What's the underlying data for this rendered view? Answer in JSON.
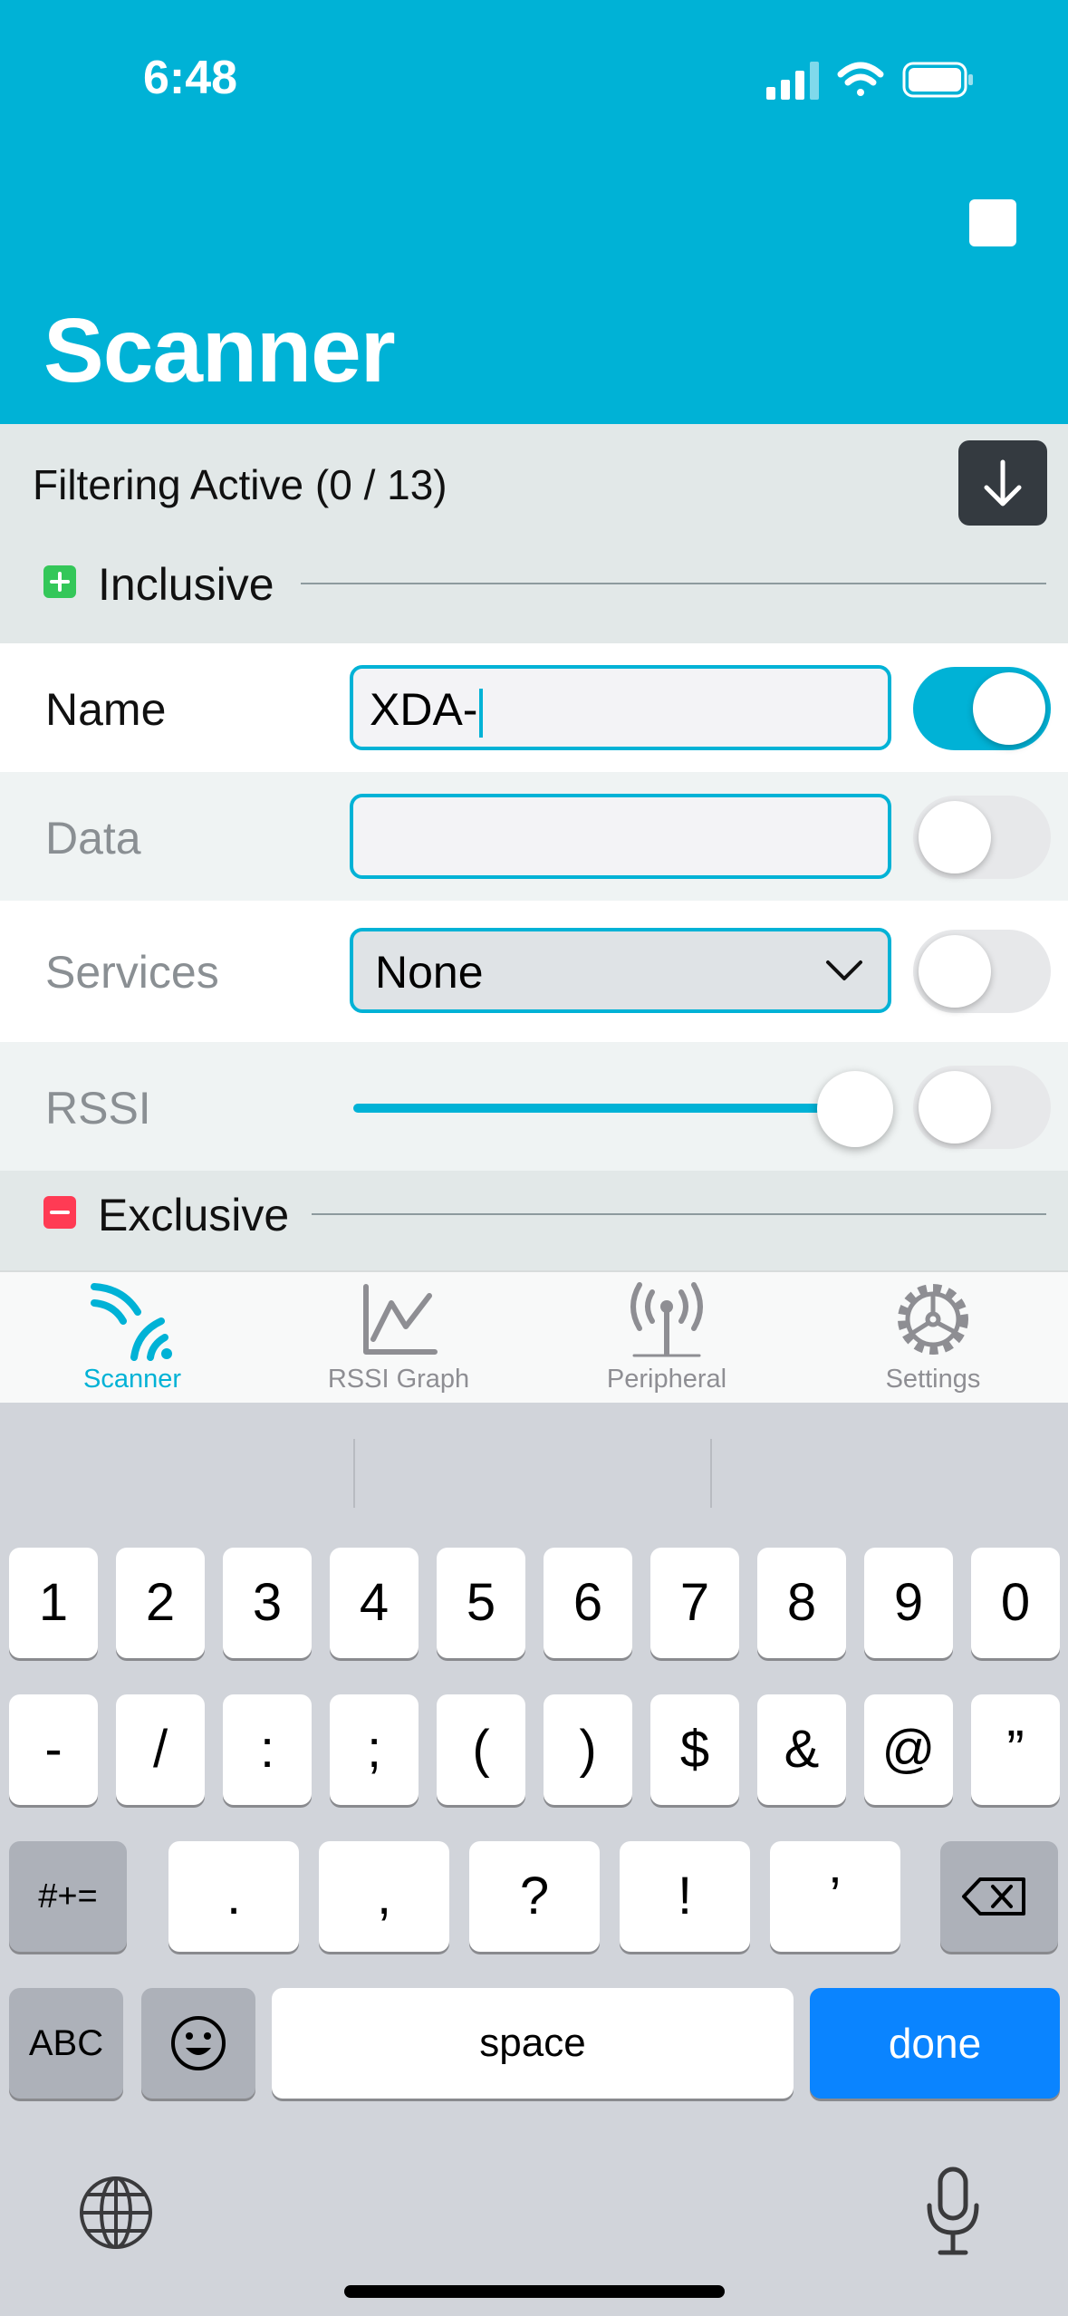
{
  "status_bar": {
    "time": "6:48"
  },
  "header": {
    "title": "Scanner"
  },
  "filter": {
    "title": "Filtering Active (0 / 13)",
    "inclusive_label": "Inclusive",
    "exclusive_label": "Exclusive",
    "rows": {
      "name": {
        "label": "Name",
        "value": "XDA-",
        "enabled": true
      },
      "data": {
        "label": "Data",
        "value": "",
        "enabled": false
      },
      "services": {
        "label": "Services",
        "value": "None",
        "enabled": false
      },
      "rssi": {
        "label": "RSSI",
        "slider_fraction": 0.95,
        "enabled": false
      }
    }
  },
  "tabs": [
    {
      "label": "Scanner",
      "icon": "scanner-icon",
      "active": true
    },
    {
      "label": "RSSI Graph",
      "icon": "graph-icon",
      "active": false
    },
    {
      "label": "Peripheral",
      "icon": "antenna-icon",
      "active": false
    },
    {
      "label": "Settings",
      "icon": "gear-icon",
      "active": false
    }
  ],
  "keyboard": {
    "row1": [
      "1",
      "2",
      "3",
      "4",
      "5",
      "6",
      "7",
      "8",
      "9",
      "0"
    ],
    "row2": [
      "-",
      "/",
      ":",
      ";",
      "(",
      ")",
      "$",
      "&",
      "@",
      "”"
    ],
    "row3": [
      "#+=",
      ".",
      ",",
      "?",
      "!",
      "’"
    ],
    "row4": [
      "ABC",
      "space",
      "done"
    ]
  },
  "colors": {
    "accent": "#00b2d6",
    "done_key": "#0a84ff",
    "inclusive_badge": "#34c759",
    "exclusive_badge": "#ff3b54"
  }
}
